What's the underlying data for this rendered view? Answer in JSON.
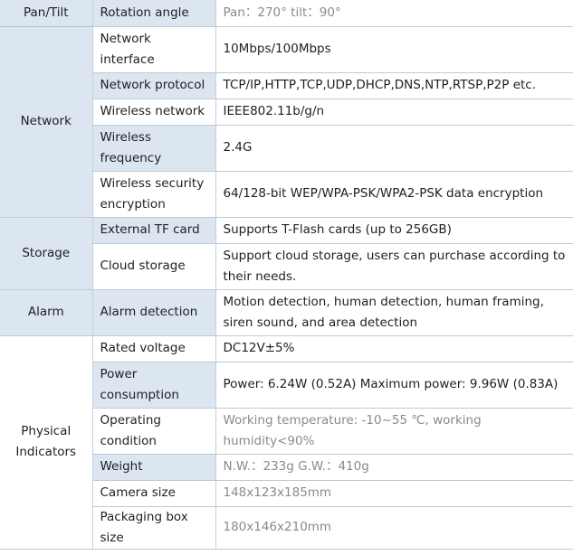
{
  "groups": [
    {
      "category": "Pan/Tilt",
      "rows": [
        {
          "name": "Rotation angle",
          "value": "Pan：270° tilt：90°",
          "muted": true
        }
      ]
    },
    {
      "category": "Network",
      "rows": [
        {
          "name": "Network interface",
          "value": "10Mbps/100Mbps"
        },
        {
          "name": "Network protocol",
          "value": "TCP/IP,HTTP,TCP,UDP,DHCP,DNS,NTP,RTSP,P2P etc."
        },
        {
          "name": "Wireless network",
          "value": "IEEE802.11b/g/n"
        },
        {
          "name": "Wireless frequency",
          "value": "2.4G"
        },
        {
          "name": "Wireless security encryption",
          "value": "64/128-bit WEP/WPA-PSK/WPA2-PSK data encryption"
        }
      ]
    },
    {
      "category": "Storage",
      "rows": [
        {
          "name": "External TF card",
          "value": "Supports T-Flash cards (up to 256GB)"
        },
        {
          "name": "Cloud storage",
          "value": "Support cloud storage, users can purchase according to their needs."
        }
      ]
    },
    {
      "category": "Alarm",
      "rows": [
        {
          "name": "Alarm detection",
          "value": "Motion detection, human detection, human framing, siren sound, and area detection"
        }
      ]
    },
    {
      "category": "Physical Indicators",
      "rows": [
        {
          "name": "Rated voltage",
          "value": "DC12V±5%"
        },
        {
          "name": "Power consumption",
          "value": "Power: 6.24W (0.52A) Maximum power: 9.96W (0.83A)"
        },
        {
          "name": "Operating condition",
          "value": "Working temperature: -10~55 ℃, working humidity<90%",
          "muted": true
        },
        {
          "name": "Weight",
          "value": "N.W.：233g G.W.：410g",
          "muted": true
        },
        {
          "name": "Camera size",
          "value": "148x123x185mm",
          "muted": true
        },
        {
          "name": "Packaging box size",
          "value": "180x146x210mm",
          "muted": true
        }
      ]
    }
  ]
}
